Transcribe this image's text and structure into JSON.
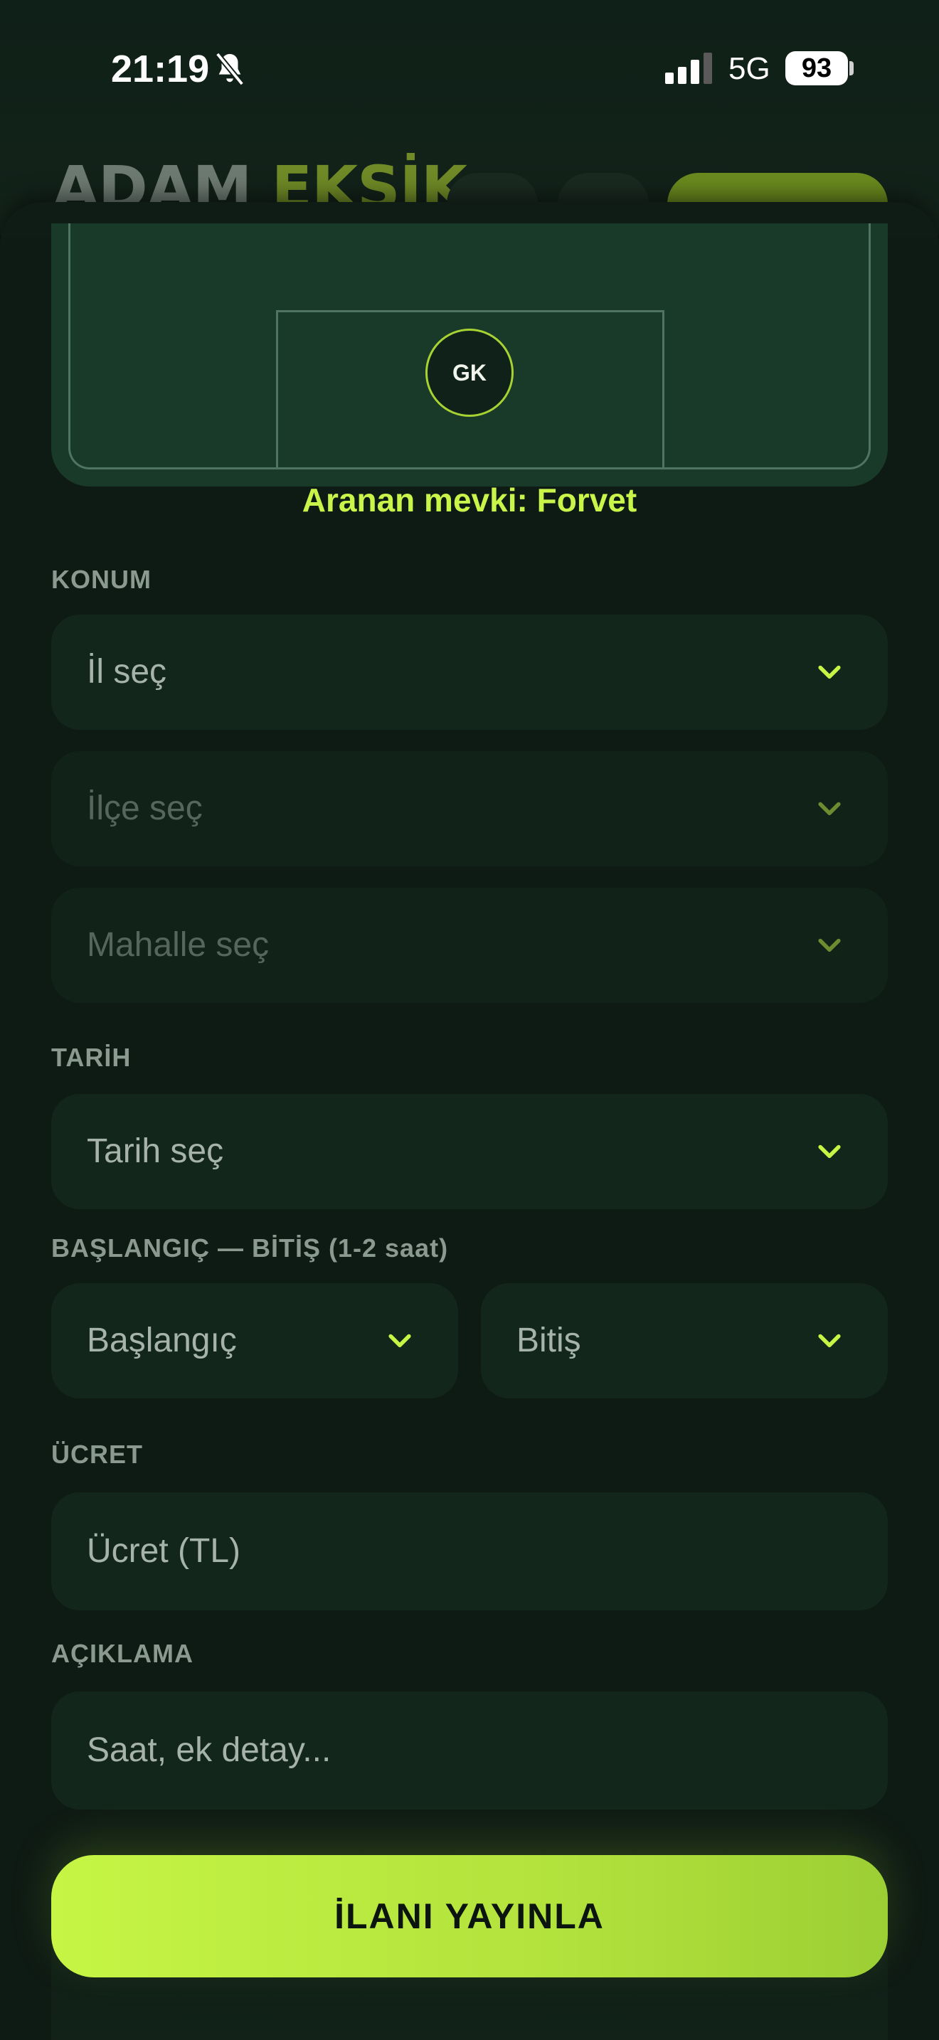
{
  "status_bar": {
    "time": "21:19",
    "network": "5G",
    "battery": "93"
  },
  "app_header": {
    "title_part1": "ADAM",
    "title_part2": "EKSİK"
  },
  "pitch": {
    "position_marker": "GK"
  },
  "searched_position": "Aranan mevki: Forvet",
  "location": {
    "label": "KONUM",
    "province_placeholder": "İl seç",
    "district_placeholder": "İlçe seç",
    "neighborhood_placeholder": "Mahalle seç"
  },
  "date": {
    "label": "TARİH",
    "placeholder": "Tarih seç"
  },
  "time_range": {
    "label": "BAŞLANGIÇ — BİTİŞ (1-2 saat)",
    "start_placeholder": "Başlangıç",
    "end_placeholder": "Bitiş"
  },
  "fee": {
    "label": "ÜCRET",
    "placeholder": "Ücret (TL)"
  },
  "description": {
    "label": "AÇIKLAMA",
    "placeholder": "Saat, ek detay..."
  },
  "publish_button": "İLANI YAYINLA",
  "colors": {
    "accent": "#c6f545",
    "background": "#0e1a14",
    "field": "#13261c"
  },
  "icons": {
    "silent": "bell-slash-icon",
    "signal": "cellular-signal-icon",
    "chevron": "chevron-down-icon"
  }
}
